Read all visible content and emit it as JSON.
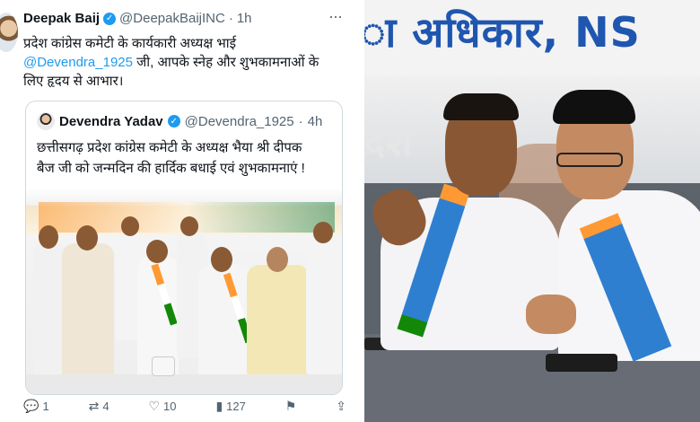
{
  "tweet": {
    "author_name": "Deepak Baij",
    "author_handle": "@DeepakBaijINC",
    "separator": "·",
    "time": "1h",
    "more": "···",
    "text_line1": "प्रदेश कांग्रेस कमेटी के कार्यकारी अध्यक्ष भाई",
    "mention": "@Devendra_1925",
    "text_line2_rest": " जी, आपके स्नेह और शुभकामनाओं के",
    "text_line3": "लिए हृदय से आभार।",
    "verified_icon": "verified-badge-icon"
  },
  "quote": {
    "author_name": "Devendra Yadav",
    "author_handle": "@Devendra_1925",
    "separator": "·",
    "time": "4h",
    "text_line1": "छत्तीसगढ़ प्रदेश कांग्रेस कमेटी के अध्यक्ष भैया श्री दीपक",
    "text_line2": "बैज जी को जन्मदिन की हार्दिक बधाई एवं शुभकामनाएं !"
  },
  "actions": {
    "reply_count": "1",
    "retweet_count": "4",
    "like_count": "10",
    "views_count": "127"
  },
  "photo": {
    "banner_top_text": "ा अधिकार, NS",
    "banner_mid_text": "देश"
  },
  "colors": {
    "verified": "#1d9bf0",
    "mention": "#1d9bf0",
    "muted": "#536471",
    "banner_blue": "#1f56b0"
  }
}
